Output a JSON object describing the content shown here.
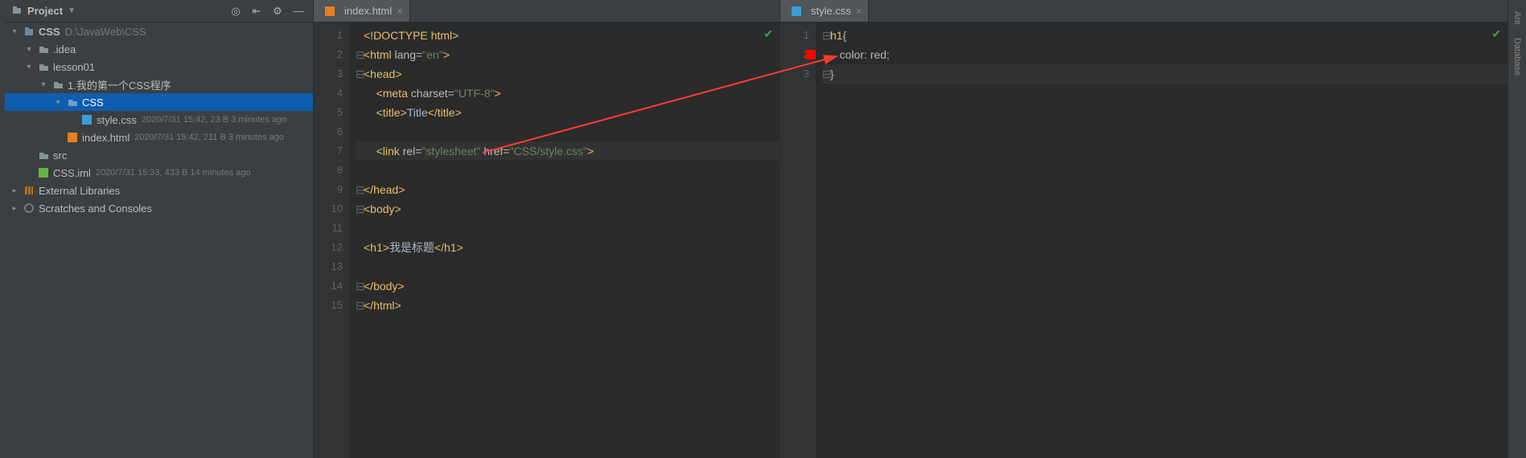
{
  "project_panel": {
    "title": "Project",
    "root_name": "CSS",
    "root_path": "D:\\JavaWeb\\CSS",
    "tree": [
      {
        "indent": 1,
        "arrow": "▾",
        "icon": "folder",
        "name": ".idea",
        "meta": ""
      },
      {
        "indent": 1,
        "arrow": "▾",
        "icon": "folder",
        "name": "lesson01",
        "meta": ""
      },
      {
        "indent": 2,
        "arrow": "▾",
        "icon": "folder",
        "name": "1.我的第一个CSS程序",
        "meta": ""
      },
      {
        "indent": 3,
        "arrow": "▾",
        "icon": "folder-blue",
        "name": "CSS",
        "meta": "",
        "selected": true
      },
      {
        "indent": 4,
        "arrow": "",
        "icon": "css",
        "name": "style.css",
        "meta": "2020/7/31 15:42, 23 B 3 minutes ago"
      },
      {
        "indent": 3,
        "arrow": "",
        "icon": "html",
        "name": "index.html",
        "meta": "2020/7/31 15:42, 211 B 3 minutes ago"
      },
      {
        "indent": 1,
        "arrow": "",
        "icon": "folder",
        "name": "src",
        "meta": ""
      },
      {
        "indent": 1,
        "arrow": "",
        "icon": "iml",
        "name": "CSS.iml",
        "meta": "2020/7/31 15:33, 433 B 14 minutes ago"
      }
    ],
    "ext_libs": "External Libraries",
    "scratches": "Scratches and Consoles"
  },
  "editor_left": {
    "tab_label": "index.html",
    "line_count": 15
  },
  "editor_right": {
    "tab_label": "style.css",
    "line_count": 3
  },
  "right_sidebar": {
    "ant": "Ant",
    "db": "Database"
  }
}
